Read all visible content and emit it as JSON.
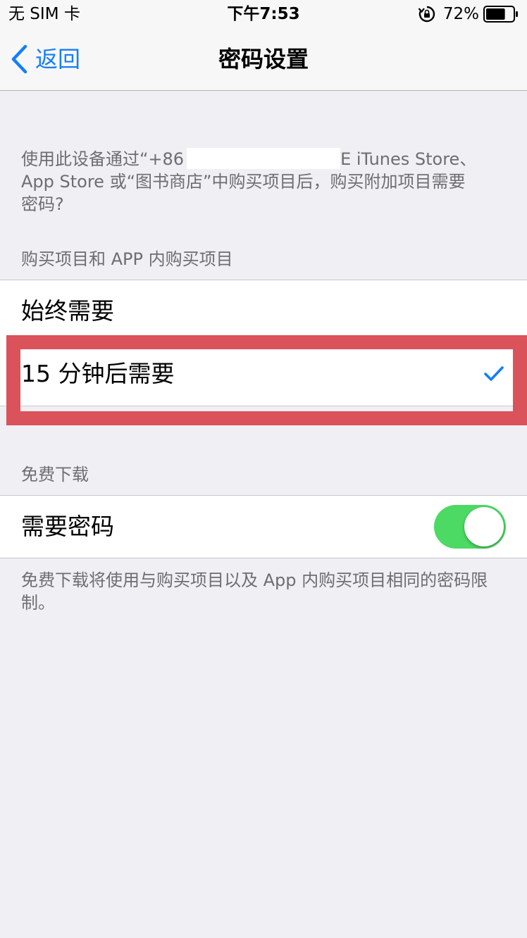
{
  "status_bar": {
    "carrier": "无 SIM 卡",
    "time": "下午7:53",
    "battery_percent": "72%",
    "battery_level": 0.72,
    "icons": [
      "rotation-lock-icon",
      "battery-icon"
    ]
  },
  "nav": {
    "back_label": "返回",
    "title": "密码设置"
  },
  "description": {
    "line1_prefix": "使用此设备通过“+86",
    "line1_suffix": "E iTunes Store、",
    "line2": "App Store 或“图书商店”中购买项目后，购买附加项目需要",
    "line3": "密码?"
  },
  "purchases": {
    "header": "购买项目和 APP 内购买项目",
    "options": [
      {
        "label": "始终需要",
        "selected": false
      },
      {
        "label": "15 分钟后需要",
        "selected": true
      }
    ]
  },
  "free_downloads": {
    "header": "免费下载",
    "require_password_label": "需要密码",
    "require_password_on": true,
    "footer": "免费下载将使用与购买项目以及 App 内购买项目相同的密码限制。"
  },
  "colors": {
    "accent": "#147efb",
    "toggle_on": "#4cd964",
    "highlight": "#da535b",
    "background": "#efeff4",
    "secondary_text": "#6d6d72"
  }
}
